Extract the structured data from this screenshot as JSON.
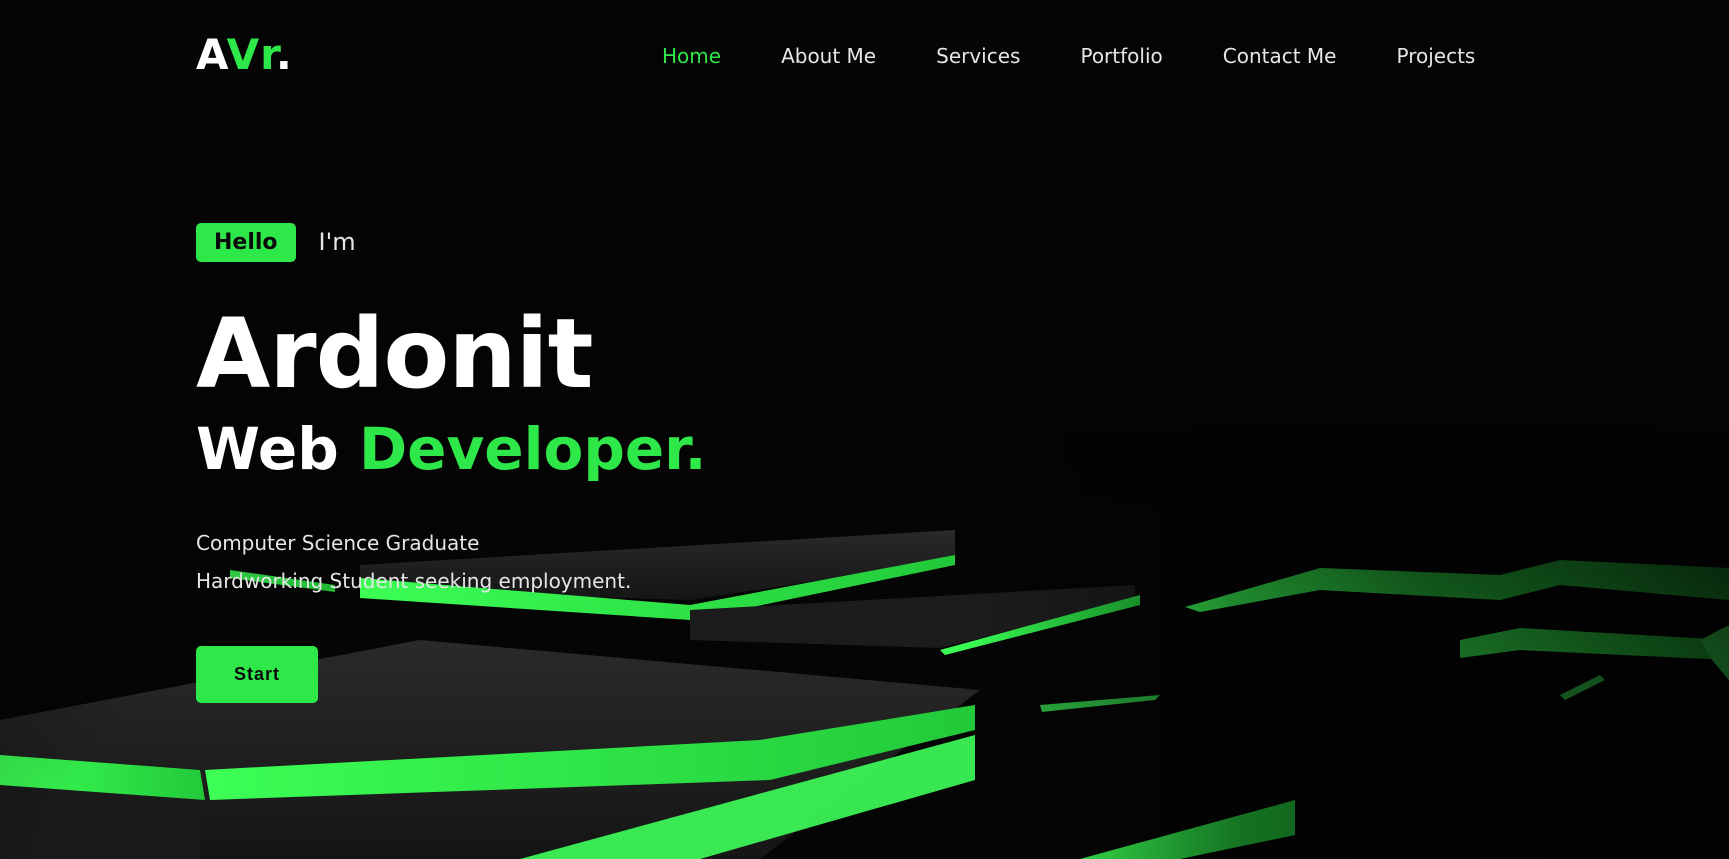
{
  "header": {
    "logo": {
      "part1": "A",
      "part2": "Vr",
      "part3": "."
    },
    "nav": [
      {
        "label": "Home",
        "active": true
      },
      {
        "label": "About Me",
        "active": false
      },
      {
        "label": "Services",
        "active": false
      },
      {
        "label": "Portfolio",
        "active": false
      },
      {
        "label": "Contact Me",
        "active": false
      },
      {
        "label": "Projects",
        "active": false
      }
    ]
  },
  "hero": {
    "badge": "Hello",
    "intro": "I'm",
    "name": "Ardonit",
    "role_word": "Web",
    "role_accent": "Developer.",
    "desc_line1": "Computer Science Graduate",
    "desc_line2": "Hardworking Student seeking employment.",
    "cta": "Start"
  },
  "colors": {
    "accent": "#2ee84a",
    "background": "#050505",
    "text": "#e6e6e6"
  }
}
